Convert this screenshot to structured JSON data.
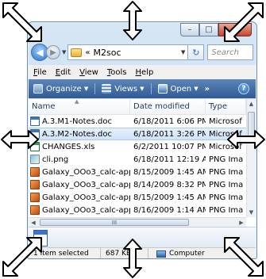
{
  "window": {
    "caption_buttons": {
      "minimize": "–",
      "maximize": "□",
      "close": "✕"
    }
  },
  "address": {
    "back_glyph": "◀",
    "forward_glyph": "▶",
    "breadcrumb_chevron": "«",
    "path": "M2soc",
    "refresh_glyph": "↻",
    "search_placeholder": "Search"
  },
  "menubar": {
    "items": [
      {
        "label": "File",
        "underline": "F",
        "rest": "ile"
      },
      {
        "label": "Edit",
        "underline": "E",
        "rest": "dit"
      },
      {
        "label": "View",
        "underline": "V",
        "rest": "iew"
      },
      {
        "label": "Tools",
        "underline": "T",
        "rest": "ools"
      },
      {
        "label": "Help",
        "underline": "H",
        "rest": "elp"
      }
    ]
  },
  "toolbar": {
    "organize_label": "Organize",
    "views_label": "Views",
    "open_label": "Open",
    "more_label": "»",
    "help_label": "?"
  },
  "columns": {
    "name": "Name",
    "date": "Date modified",
    "type": "Type"
  },
  "files": [
    {
      "name": "A.3.M1-Notes.doc",
      "date": "6/18/2011 6:06 PM",
      "type": "Microsof",
      "icon": "doc-icon",
      "selected": false
    },
    {
      "name": "A.3.M2-Notes.doc",
      "date": "6/18/2011 3:26 PM",
      "type": "Microsof",
      "icon": "doc-icon",
      "selected": true
    },
    {
      "name": "CHANGES.xls",
      "date": "6/2/2011 10:07 PM",
      "type": "Microsof",
      "icon": "xls-icon",
      "selected": false
    },
    {
      "name": "cli.png",
      "date": "6/18/2011 12:19 AM",
      "type": "PNG Ima",
      "icon": "png-icon",
      "selected": false
    },
    {
      "name": "Galaxy_OOo3_calc-app...",
      "date": "8/15/2009 1:45 AM",
      "type": "PNG Ima",
      "icon": "calc-icon",
      "selected": false
    },
    {
      "name": "Galaxy_OOo3_calc-app...",
      "date": "8/14/2009 8:32 PM",
      "type": "PNG Ima",
      "icon": "calc-icon",
      "selected": false
    },
    {
      "name": "Galaxy_OOo3_calc-app...",
      "date": "8/15/2009 1:45 AM",
      "type": "PNG Ima",
      "icon": "calc-icon",
      "selected": false
    },
    {
      "name": "Galaxy_OOo3_calc-app...",
      "date": "8/16/2009 1:14 AM",
      "type": "PNG Ima",
      "icon": "calc-icon",
      "selected": false
    }
  ],
  "scroll": {
    "h_grip": "III"
  },
  "status": {
    "selection": "1 item selected",
    "size": "687 KB",
    "location": "Computer"
  },
  "colors": {
    "toolbar": "#2f5a93",
    "selection": "#cfe3f9",
    "frame": "#c3d8ee"
  }
}
